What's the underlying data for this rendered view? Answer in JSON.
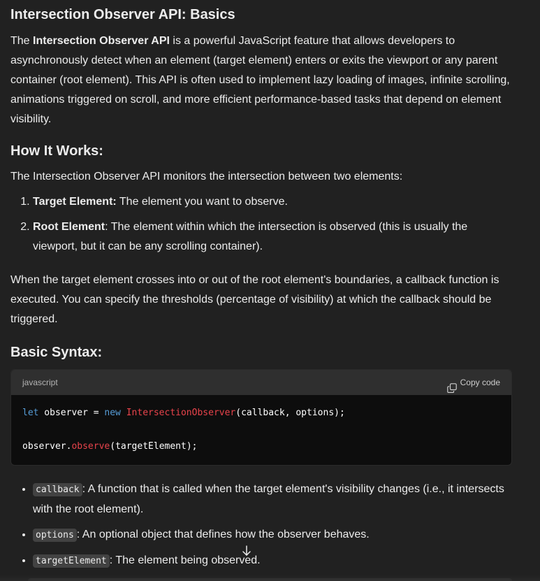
{
  "title": "Intersection Observer API: Basics",
  "intro": {
    "prefix": "The ",
    "bold": "Intersection Observer API",
    "rest": " is a powerful JavaScript feature that allows developers to asynchronously detect when an element (target element) enters or exits the viewport or any parent container (root element). This API is often used to implement lazy loading of images, infinite scrolling, animations triggered on scroll, and more efficient performance-based tasks that depend on element visibility."
  },
  "how_heading": "How It Works:",
  "monitors_text": "The Intersection Observer API monitors the intersection between two elements:",
  "ordered_items": [
    {
      "bold": "Target Element:",
      "text": " The element you want to observe."
    },
    {
      "bold": "Root Element",
      "text": ": The element within which the intersection is observed (this is usually the viewport, but it can be any scrolling container)."
    }
  ],
  "crosses_text": "When the target element crosses into or out of the root element's boundaries, a callback function is executed. You can specify the thresholds (percentage of visibility) at which the callback should be triggered.",
  "syntax_heading": "Basic Syntax:",
  "code": {
    "language": "javascript",
    "copy_label": "Copy code",
    "line1": {
      "kw1": "let",
      "t1": " observer = ",
      "kw2": "new",
      "t2": " ",
      "fn": "IntersectionObserver",
      "t3": "(callback, options);"
    },
    "line3": {
      "t1": "observer.",
      "fn": "observe",
      "t2": "(targetElement);"
    }
  },
  "bullets": [
    {
      "code": "callback",
      "text": ": A function that is called when the target element's visibility changes (i.e., it intersects with the root element)."
    },
    {
      "code": "options",
      "text": ": An optional object that defines how the observer behaves."
    },
    {
      "code": "targetElement",
      "text": ": The element being observed."
    }
  ],
  "scroll_icon": "arrow-down-icon",
  "colors": {
    "background": "#212121",
    "code_bg": "#0d0d0d",
    "code_header": "#2f2f2f",
    "keyword": "#569cd6",
    "function": "#e8434b"
  }
}
